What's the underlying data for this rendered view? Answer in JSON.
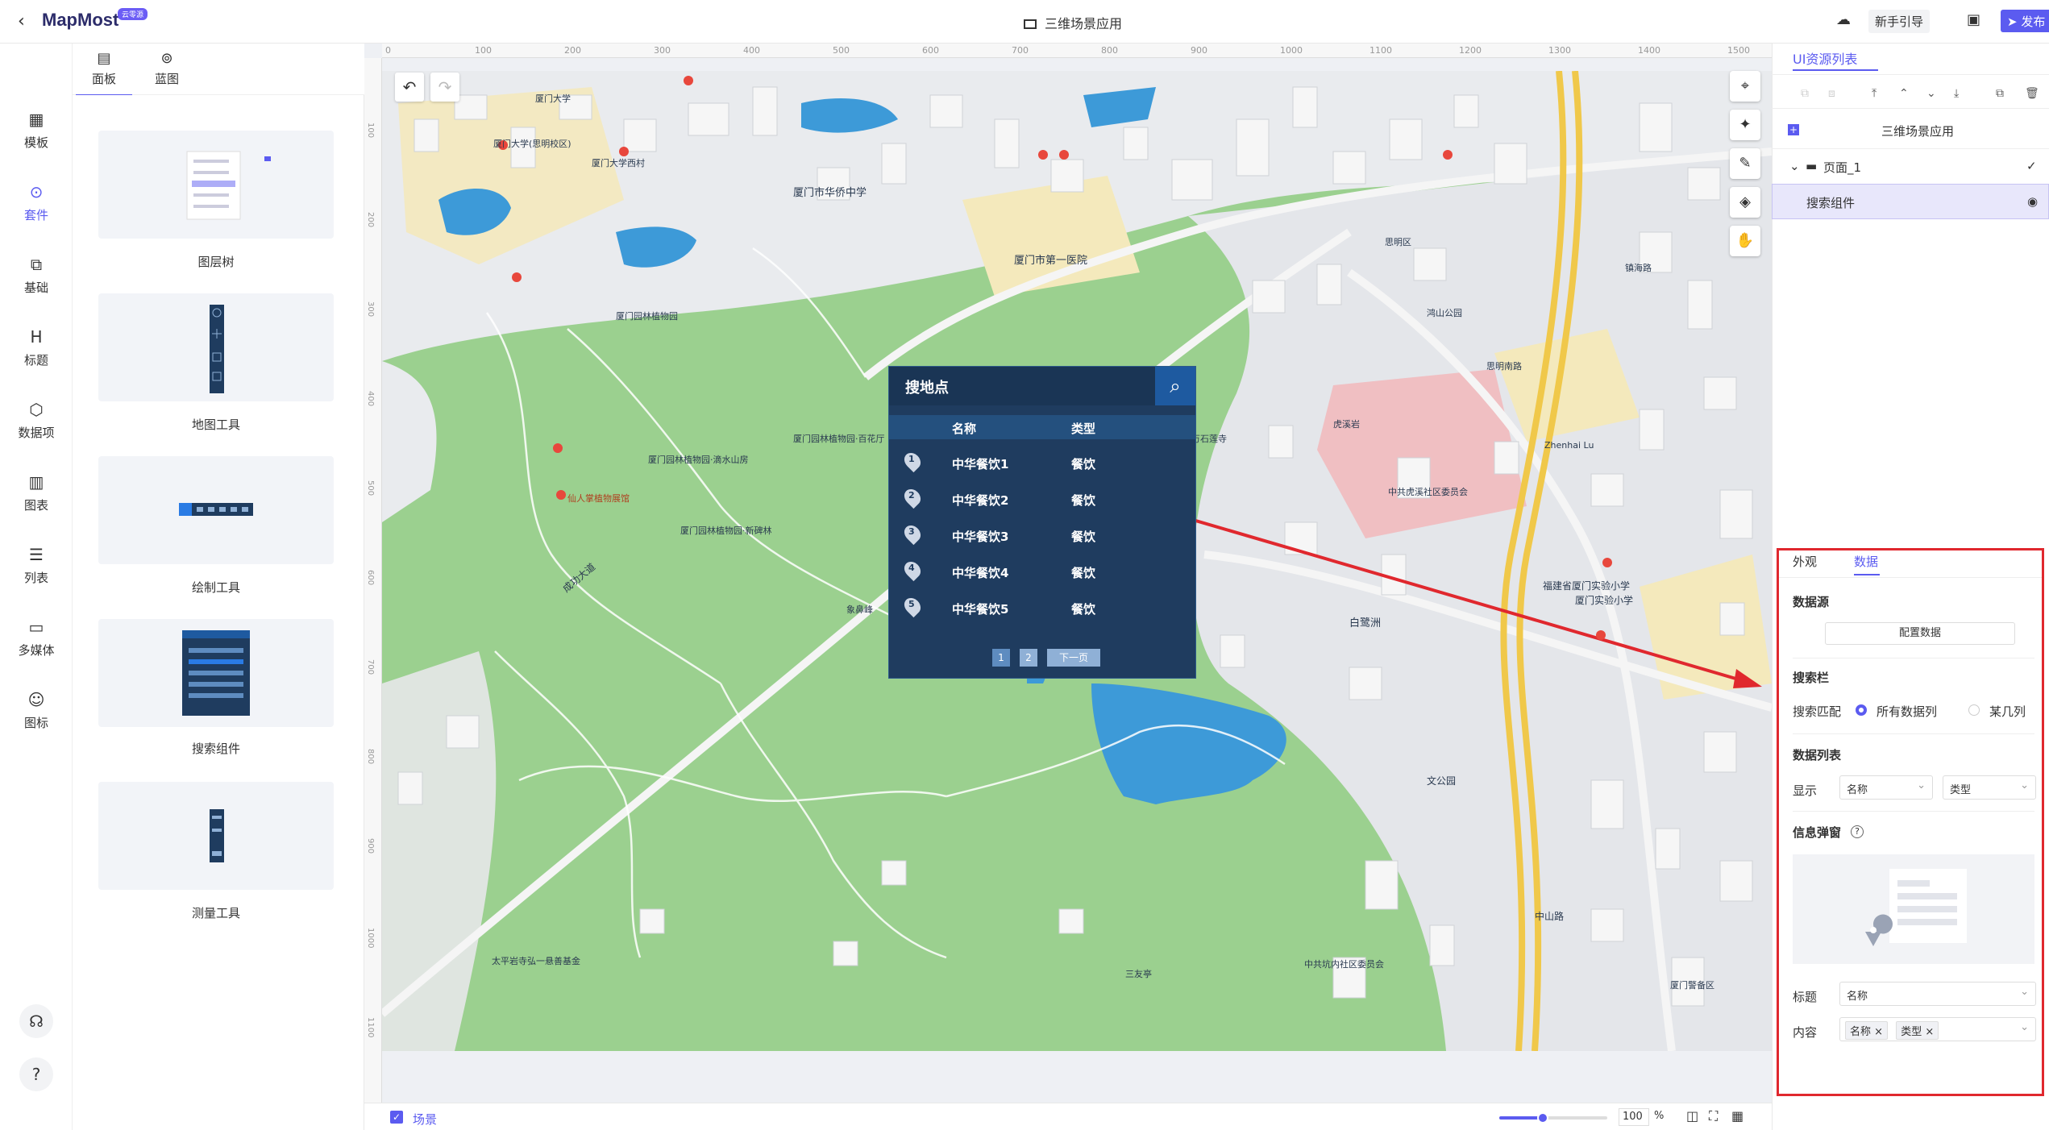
{
  "app": {
    "logo_text": "MapMost",
    "logo_badge": "云零源",
    "window_title": "三维场景应用",
    "guide_button": "新手引导",
    "publish_button": "发布"
  },
  "top_tabs": [
    {
      "label": "场景",
      "icon": "scene-icon"
    },
    {
      "label": "面板",
      "icon": "panel-icon"
    },
    {
      "label": "蓝图",
      "icon": "blueprint-icon"
    }
  ],
  "rail": [
    {
      "label": "模板",
      "icon": "template-icon"
    },
    {
      "label": "套件",
      "icon": "kit-icon"
    },
    {
      "label": "基础",
      "icon": "basic-icon"
    },
    {
      "label": "标题",
      "icon": "heading-icon"
    },
    {
      "label": "数据项",
      "icon": "data-item-icon"
    },
    {
      "label": "图表",
      "icon": "chart-icon"
    },
    {
      "label": "列表",
      "icon": "list-icon"
    },
    {
      "label": "多媒体",
      "icon": "media-icon"
    },
    {
      "label": "图标",
      "icon": "emoji-icon"
    }
  ],
  "components": [
    {
      "label": "图层树"
    },
    {
      "label": "地图工具"
    },
    {
      "label": "绘制工具"
    },
    {
      "label": "搜索组件"
    },
    {
      "label": "测量工具"
    }
  ],
  "ruler": {
    "top": [
      "0",
      "100",
      "200",
      "300",
      "400",
      "500",
      "600",
      "700",
      "800",
      "900",
      "1000",
      "1100",
      "1200",
      "1300",
      "1400",
      "1500"
    ],
    "left": [
      "100",
      "200",
      "300",
      "400",
      "500",
      "600",
      "700",
      "800",
      "900",
      "1000",
      "1100"
    ]
  },
  "map_labels": [
    "厦门大学",
    "厦门大学西村",
    "厦门大学(思明校区)",
    "厦门市华侨中学",
    "厦门市第一医院",
    "厦门园林植物园",
    "厦门园林植物园·百花厅",
    "厦门园林植物园·滴水山房",
    "厦门园林植物园·新碑林",
    "思明南路",
    "仙人掌植物展馆",
    "成功大道",
    "象鼻峰",
    "万石莲寺",
    "太平岩寺弘一悬善基金",
    "三友亭",
    "中共虎溪社区委员会",
    "中共坑内社区委员会",
    "白鹭洲",
    "厦门实验小学",
    "福建省厦门实验小学",
    "中山路",
    "Zhenhai Lu",
    "镇海路",
    "虎溪岩",
    "鸿山公园",
    "文公园",
    "思明区",
    "厦门警备区"
  ],
  "search_widget": {
    "title": "搜地点",
    "col_name": "名称",
    "col_type": "类型",
    "rows": [
      {
        "num": "1",
        "name": "中华餐饮1",
        "type": "餐饮"
      },
      {
        "num": "2",
        "name": "中华餐饮2",
        "type": "餐饮"
      },
      {
        "num": "3",
        "name": "中华餐饮3",
        "type": "餐饮"
      },
      {
        "num": "4",
        "name": "中华餐饮4",
        "type": "餐饮"
      },
      {
        "num": "5",
        "name": "中华餐饮5",
        "type": "餐饮"
      }
    ],
    "pages": [
      "1",
      "2"
    ],
    "next": "下一页"
  },
  "bottom": {
    "scene_label": "场景",
    "zoom": "100",
    "zoom_unit": "%",
    "zoom_fraction": 0.4
  },
  "right_panel": {
    "title": "UI资源列表",
    "tree": {
      "root": "三维场景应用",
      "page": "页面_1",
      "component": "搜索组件"
    },
    "props_tabs": [
      "外观",
      "数据"
    ],
    "data_source": {
      "heading": "数据源",
      "button": "配置数据"
    },
    "search_bar": {
      "heading": "搜索栏",
      "match_label": "搜索匹配",
      "option_all": "所有数据列",
      "option_some": "某几列"
    },
    "data_list": {
      "heading": "数据列表",
      "display_label": "显示",
      "col1": "名称",
      "col2": "类型"
    },
    "info_popup": {
      "heading": "信息弹窗",
      "title_label": "标题",
      "title_value": "名称",
      "content_label": "内容",
      "content_tags": [
        "名称",
        "类型"
      ]
    }
  },
  "colors": {
    "accent": "#5b5bf0",
    "highlight_box": "#e0282e",
    "widget_bg": "#1f3c5f",
    "map_green": "#9bd08f"
  }
}
